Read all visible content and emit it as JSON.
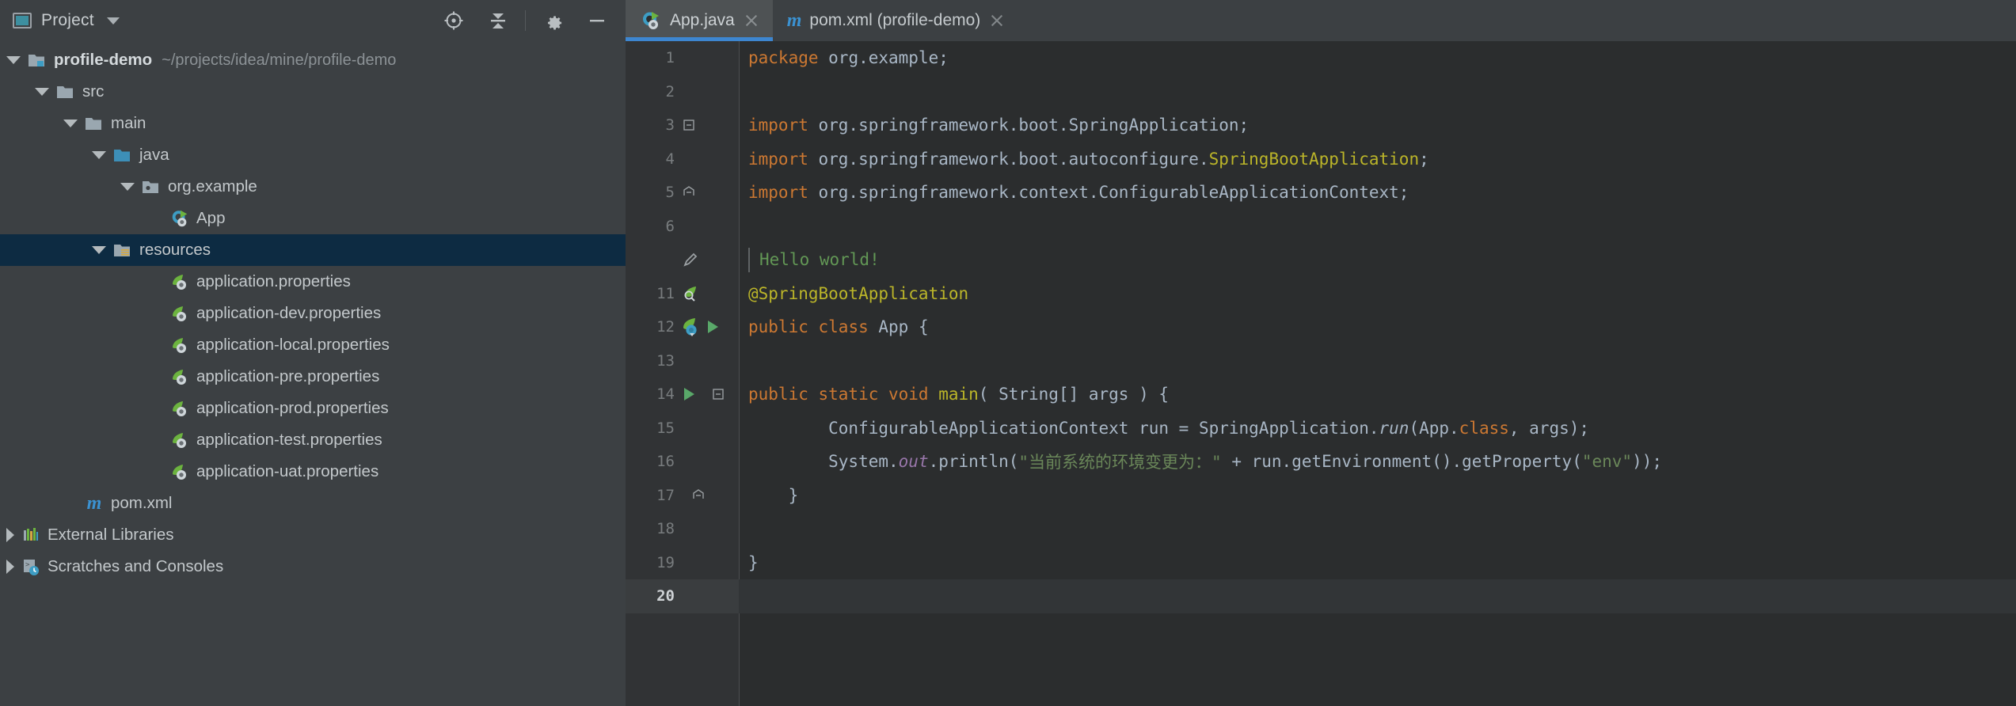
{
  "window": {
    "theme_bg": "#3c4043",
    "editor_bg": "#2b2d2e",
    "accent": "#3d86d0",
    "selection_bg": "#0d2b42"
  },
  "project_panel": {
    "title": "Project",
    "title_icon": "project-window-icon",
    "dropdown_icon": "chevron-down-icon",
    "toolbar": [
      {
        "name": "locate-icon",
        "label": "Select Opened File"
      },
      {
        "name": "collapse-all-icon",
        "label": "Collapse All"
      },
      {
        "name": "gear-icon",
        "label": "Settings"
      },
      {
        "name": "minimize-icon",
        "label": "Hide"
      }
    ]
  },
  "tabs": [
    {
      "label": "App.java",
      "icon": "java-spring-class-icon",
      "active": true,
      "close_icon": "close-icon"
    },
    {
      "label": "pom.xml (profile-demo)",
      "icon": "maven-m-icon",
      "active": false,
      "close_icon": "close-icon"
    }
  ],
  "tree": [
    {
      "label": "profile-demo",
      "secondary": "~/projects/idea/mine/profile-demo",
      "indent": 0,
      "arrow": "expanded",
      "icon": "module-folder-icon",
      "bold": true,
      "selected": false
    },
    {
      "label": "src",
      "secondary": "",
      "indent": 1,
      "arrow": "expanded",
      "icon": "folder-icon",
      "bold": false,
      "selected": false
    },
    {
      "label": "main",
      "secondary": "",
      "indent": 2,
      "arrow": "expanded",
      "icon": "folder-icon",
      "bold": false,
      "selected": false
    },
    {
      "label": "java",
      "secondary": "",
      "indent": 3,
      "arrow": "expanded",
      "icon": "source-root-folder-icon",
      "bold": false,
      "selected": false
    },
    {
      "label": "org.example",
      "secondary": "",
      "indent": 4,
      "arrow": "expanded",
      "icon": "package-icon",
      "bold": false,
      "selected": false
    },
    {
      "label": "App",
      "secondary": "",
      "indent": 5,
      "arrow": "none",
      "icon": "java-spring-class-icon",
      "bold": false,
      "selected": false
    },
    {
      "label": "resources",
      "secondary": "",
      "indent": 3,
      "arrow": "expanded",
      "icon": "resource-root-folder-icon",
      "bold": false,
      "selected": true
    },
    {
      "label": "application.properties",
      "secondary": "",
      "indent": 4,
      "arrow": "none",
      "icon": "spring-properties-icon",
      "bold": false,
      "selected": false
    },
    {
      "label": "application-dev.properties",
      "secondary": "",
      "indent": 4,
      "arrow": "none",
      "icon": "spring-properties-icon",
      "bold": false,
      "selected": false
    },
    {
      "label": "application-local.properties",
      "secondary": "",
      "indent": 4,
      "arrow": "none",
      "icon": "spring-properties-icon",
      "bold": false,
      "selected": false
    },
    {
      "label": "application-pre.properties",
      "secondary": "",
      "indent": 4,
      "arrow": "none",
      "icon": "spring-properties-icon",
      "bold": false,
      "selected": false
    },
    {
      "label": "application-prod.properties",
      "secondary": "",
      "indent": 4,
      "arrow": "none",
      "icon": "spring-properties-icon",
      "bold": false,
      "selected": false
    },
    {
      "label": "application-test.properties",
      "secondary": "",
      "indent": 4,
      "arrow": "none",
      "icon": "spring-properties-icon",
      "bold": false,
      "selected": false
    },
    {
      "label": "application-uat.properties",
      "secondary": "",
      "indent": 4,
      "arrow": "none",
      "icon": "spring-properties-icon",
      "bold": false,
      "selected": false
    },
    {
      "label": "pom.xml",
      "secondary": "",
      "indent": 2,
      "arrow": "none",
      "icon": "maven-m-icon",
      "bold": false,
      "selected": false
    },
    {
      "label": "External Libraries",
      "secondary": "",
      "indent": 0,
      "arrow": "collapsed",
      "icon": "libraries-icon",
      "bold": false,
      "selected": false
    },
    {
      "label": "Scratches and Consoles",
      "secondary": "",
      "indent": 0,
      "arrow": "collapsed",
      "icon": "scratches-icon",
      "bold": false,
      "selected": false
    }
  ],
  "editor": {
    "file": "App.java",
    "current_line": 20,
    "lines": [
      {
        "num": "1",
        "gutter_icons": [],
        "fold": "",
        "current": false
      },
      {
        "num": "2",
        "gutter_icons": [],
        "fold": "",
        "current": false
      },
      {
        "num": "3",
        "gutter_icons": [],
        "fold": "collapse-top",
        "current": false
      },
      {
        "num": "4",
        "gutter_icons": [],
        "fold": "line",
        "current": false
      },
      {
        "num": "5",
        "gutter_icons": [],
        "fold": "collapse-bottom",
        "current": false
      },
      {
        "num": "6",
        "gutter_icons": [],
        "fold": "",
        "current": false
      },
      {
        "num": "",
        "gutter_icons": [
          "pencil-icon"
        ],
        "fold": "",
        "current": false
      },
      {
        "num": "11",
        "gutter_icons": [
          "spring-bean-search-icon"
        ],
        "fold": "",
        "current": false
      },
      {
        "num": "12",
        "gutter_icons": [
          "spring-boot-icon",
          "run-triangle-icon"
        ],
        "fold": "",
        "current": false
      },
      {
        "num": "13",
        "gutter_icons": [],
        "fold": "",
        "current": false
      },
      {
        "num": "14",
        "gutter_icons": [
          "run-triangle-icon"
        ],
        "fold": "collapse-top",
        "current": false
      },
      {
        "num": "15",
        "gutter_icons": [],
        "fold": "line",
        "current": false
      },
      {
        "num": "16",
        "gutter_icons": [],
        "fold": "line",
        "current": false
      },
      {
        "num": "17",
        "gutter_icons": [],
        "fold": "collapse-bottom",
        "current": false
      },
      {
        "num": "18",
        "gutter_icons": [],
        "fold": "",
        "current": false
      },
      {
        "num": "19",
        "gutter_icons": [],
        "fold": "",
        "current": false
      },
      {
        "num": "20",
        "gutter_icons": [],
        "fold": "",
        "current": true
      }
    ],
    "code": {
      "l1_package_kw": "package",
      "l1_package_name": " org.example;",
      "l3_import_kw": "import",
      "l3_rest": " org.springframework.boot.SpringApplication;",
      "l4_import_kw": "import",
      "l4_rest": " org.springframework.boot.autoconfigure.",
      "l4_hl": "SpringBootApplication",
      "l4_semi": ";",
      "l5_import_kw": "import",
      "l5_rest": " org.springframework.context.ConfigurableApplicationContext;",
      "l_doc": "Hello world!",
      "l11_anno": "@SpringBootApplication",
      "l12_public": "public",
      "l12_class": "class",
      "l12_name": " App {",
      "l14_mods": "public static void ",
      "l14_main": "main",
      "l14_sig": "( String[] args ) {",
      "l15_type": "        ConfigurableApplicationContext run = SpringApplication.",
      "l15_run": "run",
      "l15_mid": "(App.",
      "l15_class_kw": "class",
      "l15_tail": ", args);",
      "l16_head": "        System.",
      "l16_out": "out",
      "l16_println": ".println(",
      "l16_str": "\"当前系统的环境变更为：\"",
      "l16_mid": " + run.getEnvironment().getProperty(",
      "l16_str2": "\"env\"",
      "l16_tail": "));",
      "l17_brace": "    }",
      "l19_brace": "}"
    }
  }
}
